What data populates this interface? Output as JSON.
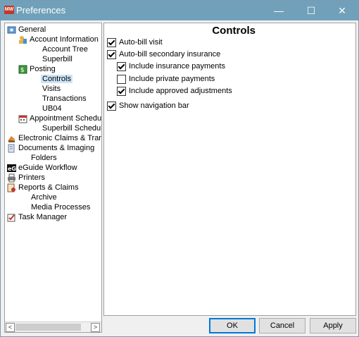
{
  "window": {
    "title": "Preferences",
    "icon_text": "MW"
  },
  "titlebar_buttons": {
    "minimize": "—",
    "maximize": "☐",
    "close": "✕"
  },
  "tree": [
    {
      "label": "General",
      "icon": "general-icon"
    },
    {
      "label": "Account Information",
      "icon": "account-icon"
    },
    {
      "label": "Account Tree"
    },
    {
      "label": "Superbill"
    },
    {
      "label": "Posting",
      "icon": "posting-icon"
    },
    {
      "label": "Controls",
      "selected": true
    },
    {
      "label": "Visits"
    },
    {
      "label": "Transactions"
    },
    {
      "label": "UB04"
    },
    {
      "label": "Appointment Scheduler",
      "icon": "calendar-icon"
    },
    {
      "label": "Superbill Scheduler"
    },
    {
      "label": "Electronic Claims & Transmis",
      "icon": "claims-icon"
    },
    {
      "label": "Documents & Imaging",
      "icon": "documents-icon"
    },
    {
      "label": "Folders"
    },
    {
      "label": "eGuide Workflow",
      "icon": "eguide-icon"
    },
    {
      "label": "Printers",
      "icon": "printer-icon"
    },
    {
      "label": "Reports & Claims",
      "icon": "reports-icon"
    },
    {
      "label": "Archive"
    },
    {
      "label": "Media Processes"
    },
    {
      "label": "Task Manager",
      "icon": "task-manager-icon"
    }
  ],
  "scroll": {
    "left": "<",
    "right": ">"
  },
  "controls": {
    "title": "Controls",
    "options": [
      {
        "label": "Auto-bill visit",
        "checked": true
      },
      {
        "label": "Auto-bill secondary insurance",
        "checked": true
      },
      {
        "label": "Include insurance payments",
        "checked": true
      },
      {
        "label": "Include private payments",
        "checked": false
      },
      {
        "label": "Include approved adjustments",
        "checked": true
      },
      {
        "label": "Show navigation bar",
        "checked": true
      }
    ]
  },
  "buttons": {
    "ok": "OK",
    "cancel": "Cancel",
    "apply": "Apply"
  }
}
